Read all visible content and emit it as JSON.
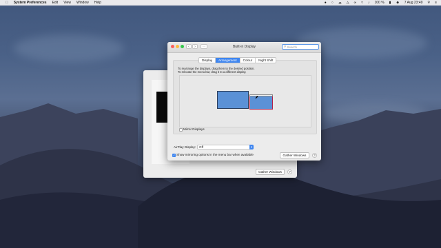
{
  "menubar": {
    "app_name": "System Preferences",
    "items": [
      "Edit",
      "View",
      "Window",
      "Help"
    ],
    "battery": "100 %",
    "datetime": "7 Aug  23:49"
  },
  "background_window": {
    "gather_label": "Gather Windows",
    "help_label": "?"
  },
  "main_window": {
    "title": "Built-in Display",
    "search_placeholder": "Search",
    "tabs": [
      {
        "label": "Display",
        "active": false
      },
      {
        "label": "Arrangement",
        "active": true
      },
      {
        "label": "Colour",
        "active": false
      },
      {
        "label": "Night Shift",
        "active": false
      }
    ],
    "instruction_line1": "To rearrange the displays, drag them to the desired position.",
    "instruction_line2": "To relocate the menu bar, drag it to a different display.",
    "mirror_label": "Mirror Displays",
    "mirror_checked": false,
    "airplay_label": "AirPlay Display:",
    "airplay_value": "Off",
    "show_mirroring_label": "Show mirroring options in the menu bar when available",
    "show_mirroring_checked": true,
    "gather_label": "Gather Windows",
    "help_label": "?"
  },
  "colors": {
    "accent": "#3f86f0",
    "display_fill": "#5b91d6",
    "selected_display_border": "#b5224a"
  }
}
